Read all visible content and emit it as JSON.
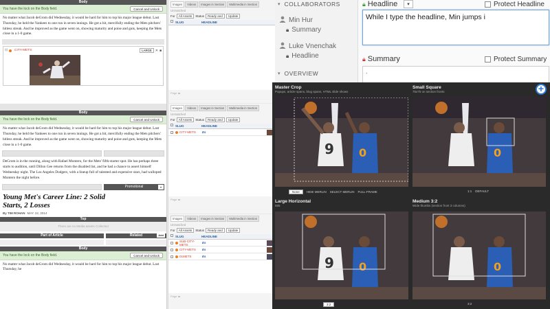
{
  "editor": {
    "body_label": "Body",
    "lock_msg": "You have the lock on the Body field.",
    "cancel_unlock": "Cancel and Unlock",
    "para1": "No matter what Jacob deGrom did Wednesday, it would be hard for him to top his major league debut. Last Thursday, he held the Yankees to one run in seven innings. He got a hit, mercifully ending the Mets pitchers' hitless streak. And he improved as the game went on, showing maturity and poise and guts, keeping the Mets close in a 1-0 game.",
    "embed_slug": "CITY-METS",
    "embed_size": "LARGE",
    "para2": "DeGrom is in the running, along with Rafael Montero, for the Mets' fifth-starter spot. He has perhaps three starts to audition, until Dillon Gee returns from the disabled list, and he had a chance to assert himself Wednesday night. The Los Angeles Dodgers, with a lineup full of talented and expensive stars, had walloped Montero the night before.",
    "promo_label": "Promotional",
    "headline": "Young Met's Career Line: 2 Solid Starts, 2 Losses",
    "byline": "By TIM ROHAN",
    "date": "MAY. 22, 2014",
    "top_label": "Top",
    "top_placeholder": "There are no Media assets Collected",
    "part_label": "Part of Article",
    "related_label": "Related",
    "add_label": "Add",
    "para3": "No matter what Jacob deGrom did Wednesday, it would be hard for him to top his major league debut. Last Thursday, he"
  },
  "media": {
    "tabs": [
      "Images",
      "Videos",
      "Images in Section",
      "Multimedia in Section",
      "Images In"
    ],
    "hint": "Unmatched",
    "for_label": "For",
    "for_value": "All Assets",
    "status_label": "Status",
    "status_value": "Ready and",
    "update": "Update",
    "col_slug": "SLUG",
    "col_headline": "HEADLINE",
    "panel2_rows": [
      {
        "slug": "CITY-METS",
        "tag": "Es"
      }
    ],
    "panel3_rows": [
      {
        "slug": "SUB-CITY-METS",
        "tag": "Es"
      },
      {
        "slug": "CITY-METS",
        "tag": "Es"
      },
      {
        "slug": "01METS",
        "tag": "Es"
      }
    ],
    "pager": "Page"
  },
  "collab": {
    "title": "COLLABORATORS",
    "user1": "Min Hur",
    "user1_field": "Summary",
    "user2": "Luke Vnenchak",
    "user2_field": "Headline",
    "overview": "OVERVIEW"
  },
  "fields": {
    "headline_label": "Headline",
    "protect_headline": "Protect Headline",
    "headline_value": "While I type the headline, Min jumps i",
    "summary_label": "Summary",
    "protect_summary": "Protect Summary",
    "summary_value": "."
  },
  "crops": [
    {
      "title": "Master Crop",
      "sub": "Popups, article spans, blog spans, HTML slide shows"
    },
    {
      "title": "Small Square",
      "sub": "75x75 on section fronts"
    },
    {
      "title": "Large Horizontal",
      "sub": "585"
    },
    {
      "title": "Medium 3:2",
      "sub": "Wide thumbs (section front 3 columns)"
    }
  ],
  "crop_controls": {
    "none": "None",
    "hide": "HIDE MERLIN",
    "select": "SELECT MERLIN",
    "full": "FULL-FRAME",
    "ratio": "1:1",
    "default": "DEFAULT",
    "ratio32": "3:2"
  },
  "colors": {
    "accent": "#f07a1c",
    "slug": "#d43b2b",
    "link": "#2a5a9b",
    "lock_green": "#dcefd4"
  }
}
